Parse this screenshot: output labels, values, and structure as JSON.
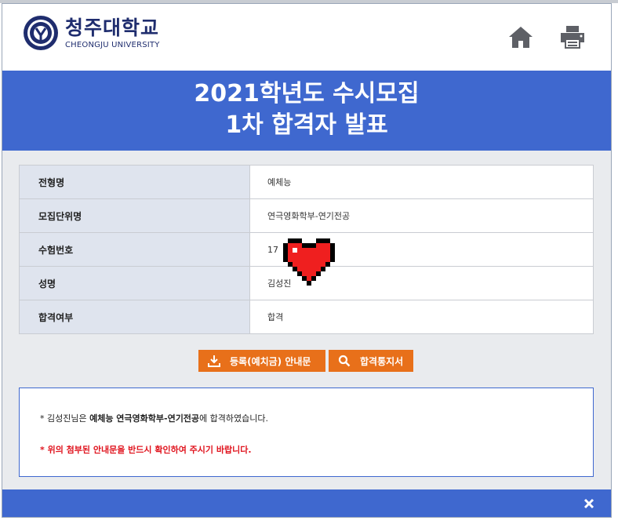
{
  "header": {
    "logo_korean": "청주대학교",
    "logo_english": "CHEONGJU UNIVERSITY",
    "home_icon": "home-icon",
    "print_icon": "print-icon"
  },
  "banner": {
    "line1": "2021학년도 수시모집",
    "line2": "1차 합격자 발표"
  },
  "result_table": {
    "rows": [
      {
        "label": "전형명",
        "value": "예체능"
      },
      {
        "label": "모집단위명",
        "value": "연극영화학부-연기전공"
      },
      {
        "label": "수험번호",
        "value": "17"
      },
      {
        "label": "성명",
        "value": "김성진"
      },
      {
        "label": "합격여부",
        "value": "합격"
      }
    ]
  },
  "buttons": {
    "registration_guide": "등록(예치금) 안내문",
    "acceptance_notice": "합격통지서"
  },
  "notice": {
    "prefix": "* 김성진님은 ",
    "highlight": "예체능 연극영화학부-연기전공",
    "suffix": "에 합격하였습니다.",
    "warning": "* 위의 첨부된 안내문을 반드시 확인하여 주시기 바랍니다."
  },
  "colors": {
    "banner_blue": "#3f68cf",
    "button_orange": "#e8701a",
    "warning_red": "#e0141e",
    "brand_navy": "#1f2d6e"
  }
}
